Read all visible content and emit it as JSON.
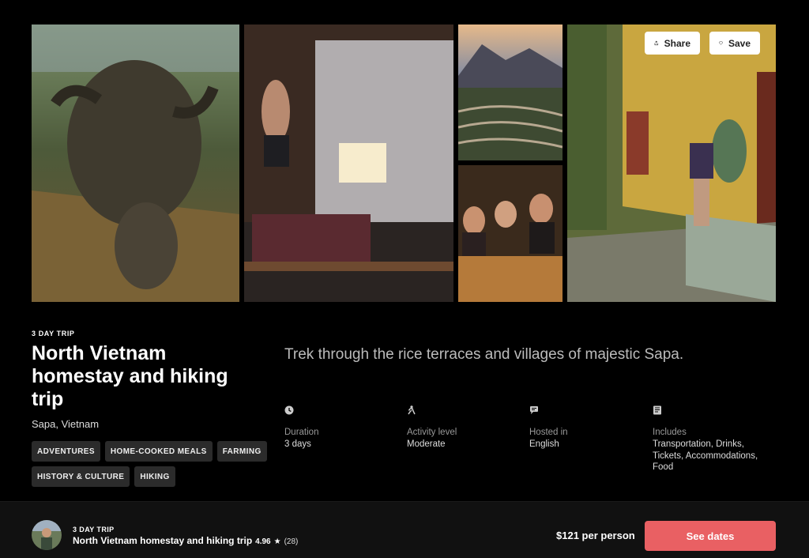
{
  "gallery": {
    "share_label": "Share",
    "save_label": "Save"
  },
  "trip": {
    "eyebrow": "3 DAY TRIP",
    "title": "North Vietnam homestay and hiking trip",
    "location": "Sapa, Vietnam",
    "tags": [
      "ADVENTURES",
      "HOME-COOKED MEALS",
      "FARMING",
      "HISTORY & CULTURE",
      "HIKING"
    ],
    "tagline": "Trek through the rice terraces and villages of majestic Sapa.",
    "details": {
      "duration": {
        "label": "Duration",
        "value": "3 days",
        "icon": "clock-icon"
      },
      "activity": {
        "label": "Activity level",
        "value": "Moderate",
        "icon": "hiker-icon"
      },
      "hosted": {
        "label": "Hosted in",
        "value": "English",
        "icon": "chat-bubble-icon"
      },
      "includes": {
        "label": "Includes",
        "value": "Transportation, Drinks, Tickets, Accommodations, Food",
        "icon": "list-icon"
      }
    }
  },
  "bottom_bar": {
    "eyebrow": "3 DAY TRIP",
    "title": "North Vietnam homestay and hiking trip",
    "rating": "4.96",
    "reviews": "(28)",
    "price": "$121 per person",
    "cta": "See dates"
  },
  "colors": {
    "accent": "#e96063",
    "background": "#000000",
    "bar": "#111111"
  }
}
